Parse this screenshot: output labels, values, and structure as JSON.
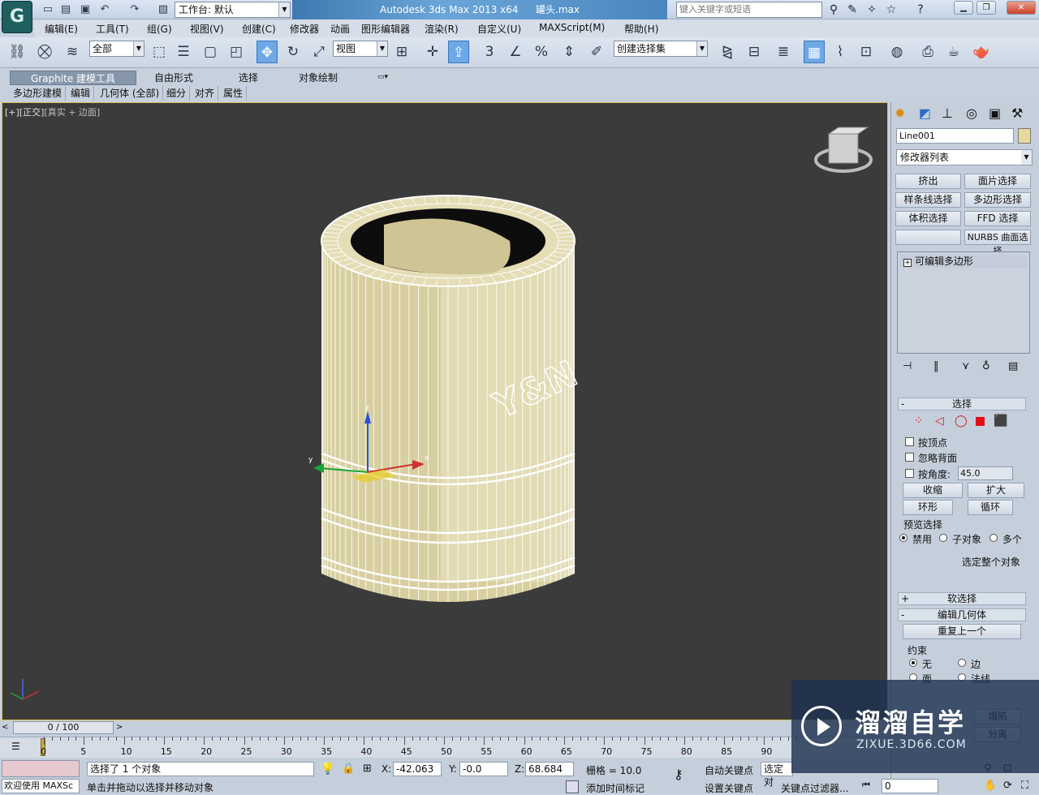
{
  "titlebar": {
    "app_logo": "G",
    "workspace": "工作台: 默认",
    "app_title": "Autodesk 3ds Max  2013 x64",
    "file_name": "罐头.max",
    "search_placeholder": "键入关键字或短语"
  },
  "menubar": {
    "items": [
      "编辑(E)",
      "工具(T)",
      "组(G)",
      "视图(V)",
      "创建(C)",
      "修改器",
      "动画",
      "图形编辑器",
      "渲染(R)",
      "自定义(U)",
      "MAXScript(M)",
      "帮助(H)"
    ]
  },
  "toolbar": {
    "selection_filter": "全部",
    "ref_coord": "视图",
    "named_selection": "创建选择集",
    "snap_3": "3",
    "snap_percent": "%"
  },
  "ribbon": {
    "tabs": [
      "Graphite 建模工具",
      "自由形式",
      "选择",
      "对象绘制"
    ],
    "subtabs": [
      "多边形建模",
      "编辑",
      "几何体 (全部)",
      "细分",
      "对齐",
      "属性"
    ]
  },
  "viewport": {
    "label_prefix": "[+]",
    "label_view": "[正交]",
    "label_shading": "[真实 + 边面]",
    "model_text": "Y&N"
  },
  "command_panel": {
    "object_name": "Line001",
    "object_color": "#e8d9a0",
    "modifier_list": "修改器列表",
    "mod_buttons": [
      "挤出",
      "面片选择",
      "样条线选择",
      "多边形选择",
      "体积选择",
      "FFD 选择",
      "",
      "NURBS 曲面选择"
    ],
    "stack_item": "可编辑多边形",
    "stack_expand": "+",
    "selection_rollout": {
      "title": "选择",
      "by_vertex": "按顶点",
      "ignore_backface": "忽略背面",
      "by_angle": "按角度:",
      "angle_value": "45.0",
      "shrink": "收缩",
      "grow": "扩大",
      "ring": "环形",
      "loop": "循环",
      "preview_title": "预览选择",
      "preview_disable": "禁用",
      "preview_subobj": "子对象",
      "preview_multi": "多个",
      "select_whole": "选定整个对象"
    },
    "soft_selection": "软选择",
    "edit_geometry": "编辑几何体",
    "repeat_last": "重复上一个",
    "constraint_title": "约束",
    "constraint_none": "无",
    "constraint_edge": "边",
    "constraint_face": "面",
    "constraint_normal": "法线",
    "rollout_plus": "+",
    "rollout_minus": "-",
    "btn_collapse": "塌陷",
    "btn_detach": "分离"
  },
  "timeline": {
    "frame_counter": "0 / 100",
    "ticks": [
      "0",
      "5",
      "10",
      "15",
      "20",
      "25",
      "30",
      "35",
      "40",
      "45",
      "50",
      "55",
      "60",
      "65",
      "70",
      "75",
      "80",
      "85",
      "90"
    ]
  },
  "status": {
    "maxscript_listener": "欢迎使用 MAXSc",
    "selected_info": "选择了 1 个对象",
    "prompt": "单击并拖动以选择并移动对象",
    "x_label": "X:",
    "x_value": "-42.063",
    "y_label": "Y:",
    "y_value": "-0.0",
    "z_label": "Z:",
    "z_value": "68.684",
    "grid": "栅格 = 10.0",
    "auto_key": "自动关键点",
    "set_key": "设置关键点",
    "selected_obj": "选定对",
    "key_filter": "关键点过滤器...",
    "add_time_tag": "添加时间标记",
    "frame_field": "0"
  },
  "watermark": {
    "brand": "溜溜自学",
    "url": "ZIXUE.3D66.COM"
  },
  "colors": {
    "viewport_bg": "#3b3b3b",
    "model_fill": "#d8cfa0",
    "wireframe": "#ffffff",
    "active_border": "#d7c04e"
  }
}
